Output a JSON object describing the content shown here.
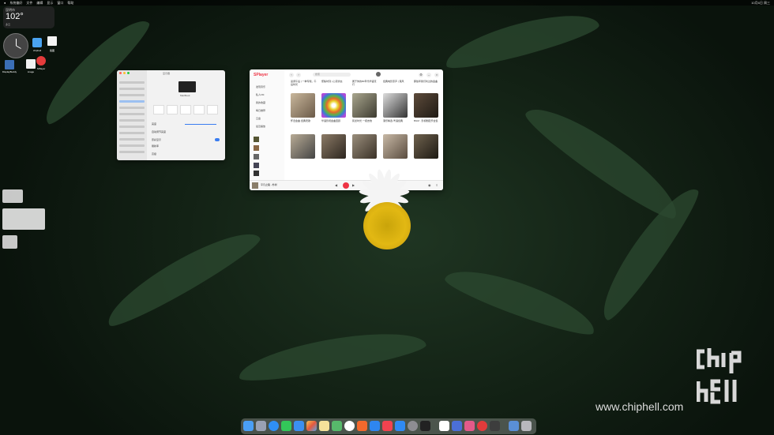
{
  "menubar": {
    "app_name": "系统偏好",
    "items": [
      "文件",
      "编辑",
      "显示",
      "窗口",
      "帮助"
    ],
    "right_status": "10月6日 周三"
  },
  "weather": {
    "city": "昆明市",
    "temp": "102°",
    "desc": "多云"
  },
  "desktop_icons": [
    {
      "name": "folder-icon",
      "label": "chiphell"
    },
    {
      "name": "document-icon",
      "label": "截图"
    },
    {
      "name": "monitor-icon",
      "label": "DisplayBuddy"
    },
    {
      "name": "document-icon-2",
      "label": "image"
    },
    {
      "name": "splayer-icon",
      "label": "SPlayer"
    }
  ],
  "settings": {
    "title": "显示器",
    "preview_label": "MacBook",
    "rows": [
      {
        "label": "亮度",
        "value": ""
      },
      {
        "label": "自动调节亮度",
        "value": ""
      },
      {
        "label": "原彩显示",
        "value": ""
      },
      {
        "label": "刷新率",
        "value": ""
      },
      {
        "label": "高级",
        "value": ""
      }
    ]
  },
  "player": {
    "logo": "SPlayer",
    "search_placeholder": "搜索",
    "nav": [
      "发现音乐",
      "私人FM",
      "我的收藏",
      "每日推荐",
      "云盘",
      "最近播放"
    ],
    "cards_row1": [
      {
        "title": "蓝调午后 | 一季专辑，午后时光"
      },
      {
        "title": "聚焦时刻 | 心流状态"
      },
      {
        "title": "属于你的80年代华语流行"
      },
      {
        "title": "经典电影原声 | 港风"
      },
      {
        "title": "那些年我们听过的金曲"
      }
    ],
    "cards_row2": [
      {
        "title": "怀旧金曲·经典老歌"
      },
      {
        "title": "华语影视金曲回顾"
      },
      {
        "title": "民谣时光·一把吉他"
      },
      {
        "title": "港乐精选·粤语经典"
      },
      {
        "title": "BGM · 影视剧配乐合集"
      }
    ],
    "now_playing": "平凡之路 - 朴树"
  },
  "dock": {
    "icons": [
      "finder-icon",
      "launchpad-icon",
      "safari-icon",
      "messages-icon",
      "mail-icon",
      "photos-icon",
      "notes-icon",
      "maps-icon",
      "settings-icon",
      "chrome-icon",
      "qq-icon",
      "music-icon",
      "appstore-icon",
      "terminal-icon",
      "trash-icon"
    ]
  },
  "watermark": {
    "site": "www.chiphell.com"
  },
  "colors": {
    "accent": "#e33b3b",
    "dock_bg": "#c8c8c8"
  }
}
